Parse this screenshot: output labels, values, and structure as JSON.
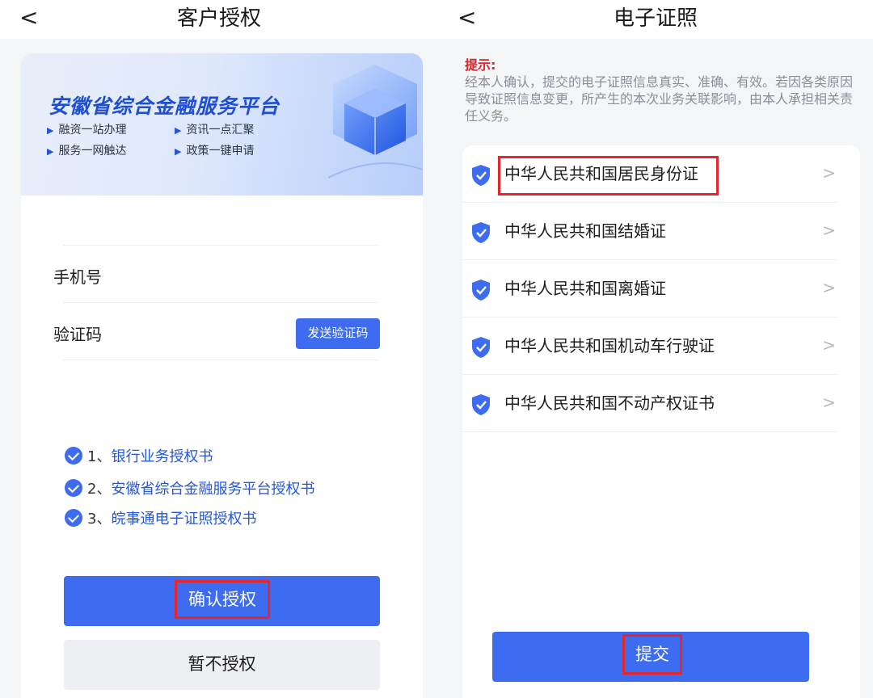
{
  "left": {
    "nav": {
      "back": "<",
      "title": "客户授权"
    },
    "banner": {
      "title": "安徽省综合金融服务平台",
      "features": [
        "融资一站办理",
        "资讯一点汇聚",
        "服务一网触达",
        "政策一键申请"
      ]
    },
    "form": {
      "phone_label": "手机号",
      "code_label": "验证码",
      "send_code": "发送验证码"
    },
    "agreements": [
      {
        "num": "1、",
        "label": "银行业务授权书"
      },
      {
        "num": "2、",
        "label": "安徽省综合金融服务平台授权书"
      },
      {
        "num": "3、",
        "label": "皖事通电子证照授权书"
      }
    ],
    "confirm": "确认授权",
    "deny": "暂不授权"
  },
  "right": {
    "nav": {
      "back": "<",
      "title": "电子证照"
    },
    "tip": {
      "title": "提示:",
      "text": "经本人确认，提交的电子证照信息真实、准确、有效。若因各类原因导致证照信息变更，所产生的本次业务关联影响，由本人承担相关责任义务。"
    },
    "documents": [
      "中华人民共和国居民身份证",
      "中华人民共和国结婚证",
      "中华人民共和国离婚证",
      "中华人民共和国机动车行驶证",
      "中华人民共和国不动产权证书"
    ],
    "chevron": ">",
    "submit": "提交"
  },
  "colors": {
    "accent": "#3d6cf0",
    "highlight": "#e5262c",
    "tip": "#d8262c"
  }
}
